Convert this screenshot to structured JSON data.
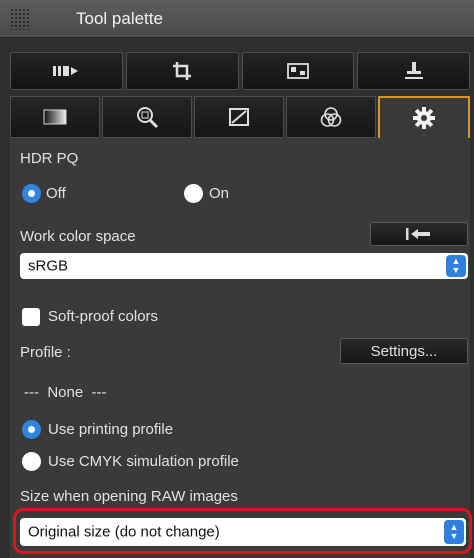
{
  "window": {
    "title": "Tool palette"
  },
  "toolbar": {
    "icons": [
      "brush-tool-icon",
      "crop-tool-icon",
      "image-adjust-icon",
      "stamp-tool-icon"
    ]
  },
  "tabs": {
    "icons": [
      "tone-tab-icon",
      "detail-tab-icon",
      "lens-tab-icon",
      "color-tab-icon",
      "settings-tab-icon"
    ],
    "active_index": 4
  },
  "hdr": {
    "heading": "HDR PQ",
    "options": [
      {
        "label": "Off",
        "selected": true
      },
      {
        "label": "On",
        "selected": false
      }
    ]
  },
  "work_color": {
    "label": "Work color space",
    "value": "sRGB"
  },
  "softproof": {
    "label": "Soft-proof colors",
    "checked": false,
    "profile_label": "Profile :",
    "settings_label": "Settings...",
    "profile_value": "---  None  ---",
    "options": [
      {
        "label": "Use printing profile",
        "selected": true
      },
      {
        "label": "Use CMYK simulation profile",
        "selected": false
      }
    ]
  },
  "raw": {
    "label": "Size when opening RAW images",
    "value": "Original size (do not change)"
  },
  "colors": {
    "accent": "#2f86e0",
    "active_tab_border": "#d8962a",
    "highlight": "#e0141a"
  }
}
